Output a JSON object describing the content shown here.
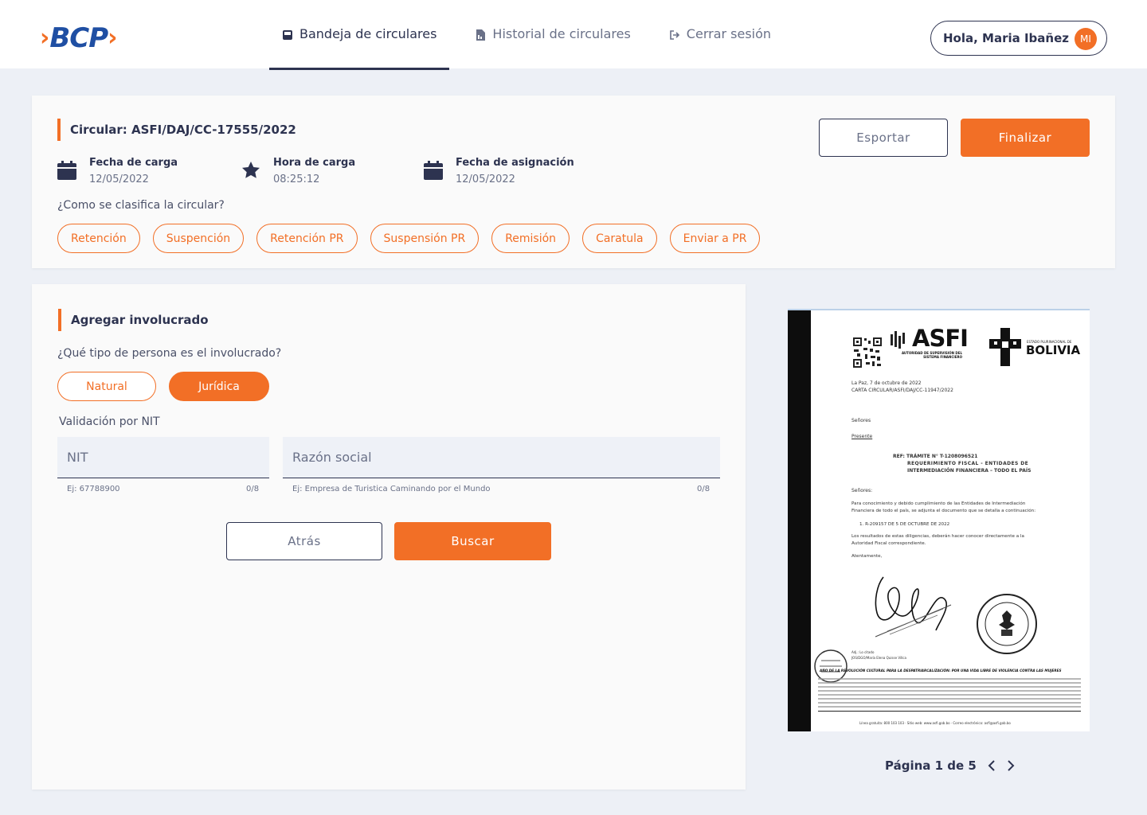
{
  "header": {
    "logo_text": "BCP",
    "nav": [
      {
        "label": "Bandeja de circulares",
        "icon": "inbox-icon"
      },
      {
        "label": "Historial de circulares",
        "icon": "document-icon"
      },
      {
        "label": "Cerrar sesión",
        "icon": "logout-icon"
      }
    ],
    "greeting": "Hola, Maria Ibañez",
    "avatar_initials": "MI"
  },
  "circular": {
    "title": "Circular: ASFI/DAJ/CC-17555/2022",
    "meta": [
      {
        "label": "Fecha de carga",
        "value": "12/05/2022",
        "icon": "calendar-icon"
      },
      {
        "label": "Hora de carga",
        "value": "08:25:12",
        "icon": "star-icon"
      },
      {
        "label": "Fecha de asignación",
        "value": "12/05/2022",
        "icon": "calendar-icon"
      }
    ],
    "question": "¿Como se clasifica la circular?",
    "classifications": [
      "Retención",
      "Suspención",
      "Retención PR",
      "Suspensión PR",
      "Remisión",
      "Caratula",
      "Enviar a PR"
    ],
    "export_label": "Esportar",
    "finish_label": "Finalizar"
  },
  "involucrado": {
    "title": "Agregar involucrado",
    "question": "¿Qué tipo de persona es el involucrado?",
    "person_types": [
      "Natural",
      "Jurídica"
    ],
    "selected_type": "Jurídica",
    "validation_label": "Validación por NIT",
    "nit": {
      "placeholder": "NIT",
      "value": "",
      "hint": "Ej: 67788900",
      "counter": "0/8"
    },
    "razon": {
      "placeholder": "Razón social",
      "value": "",
      "hint": "Ej: Empresa de Turistica Caminando por el Mundo",
      "counter": "0/8"
    },
    "back_label": "Atrás",
    "search_label": "Buscar"
  },
  "document": {
    "org": "ASFI",
    "org_sub": "AUTORIDAD DE SUPERVISIÓN DEL SISTEMA FINANCIERO",
    "country_small": "ESTADO PLURINACIONAL DE",
    "country": "BOLIVIA",
    "date_line": "La Paz, 7 de octubre de 2022",
    "ref_line": "CARTA CIRCULAR/ASFI/DAJ/CC-11947/2022",
    "senores": "Señores",
    "presente": "Presente",
    "ref1": "REF: TRÁMITE N° T-1208096521",
    "ref2": "REQUERIMIENTO FISCAL - ENTIDADES DE",
    "ref3": "INTERMEDIACIÓN FINANCIERA – TODO EL PAÍS",
    "senores2": "Señores:",
    "body1": "Para conocimiento y debido cumplimiento de las Entidades de Intermediación",
    "body2": "Financiera de todo el país, se adjunta el documento que se detalla a continuación:",
    "item1": "1.  R-209157 DE 5 DE OCTUBRE DE 2022",
    "body3": "Los resultados de estas diligencias, deberán hacer conocer directamente a la",
    "body4": "Autoridad Fiscal correspondiente.",
    "closing": "Atentamente,",
    "footer_title": "AÑO DE LA REVOLUCIÓN CULTURAL PARA LA DESPATRIARCALIZACIÓN: POR UNA VIDA LIBRE DE VIOLENCIA CONTRA LAS MUJERES",
    "footer_web": "Línea gratuita: 800 103 103 · Sitio web: www.asfi.gob.bo · Correo electrónico: asfi@asfi.gob.bo"
  },
  "pager": {
    "label": "Página 1 de 5"
  },
  "colors": {
    "accent": "#f26f26",
    "brand_blue": "#1f4fa3",
    "navy": "#2d3350",
    "background": "#edf0f6"
  }
}
